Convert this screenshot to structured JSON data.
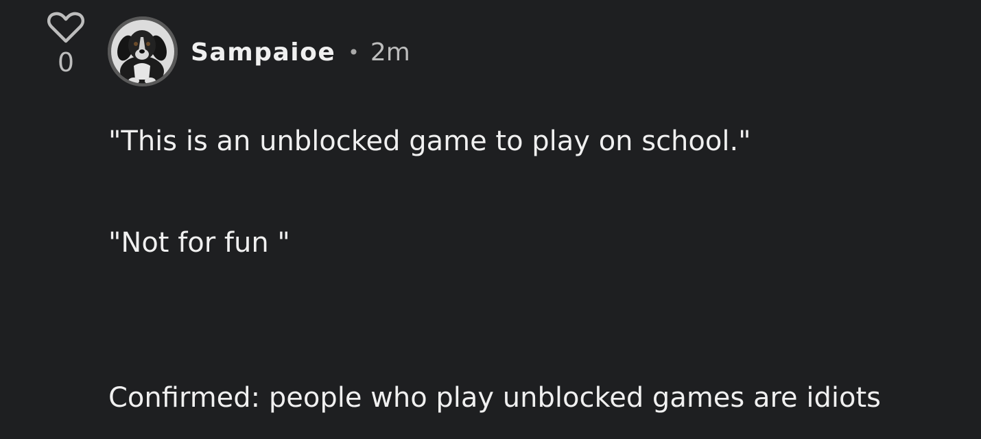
{
  "comment": {
    "likes": {
      "icon": "heart-icon",
      "count": "0"
    },
    "author": {
      "avatar": "dog-avatar",
      "name": "Sampaioe"
    },
    "separator": "•",
    "timestamp": "2m",
    "body": {
      "line1": "\"This is an unblocked game to play on school.\"",
      "line2": "\"Not for fun \"",
      "line3": "Confirmed: people who play unblocked games are idiots"
    }
  },
  "colors": {
    "background": "#1e1f21",
    "text": "#f0f0f0",
    "muted": "#bdbdbd"
  }
}
